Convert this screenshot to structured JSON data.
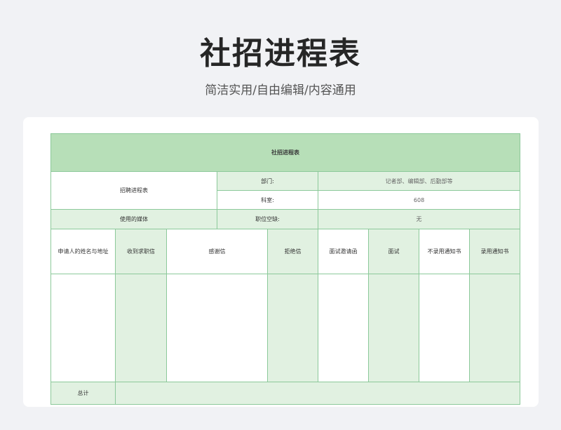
{
  "header": {
    "title": "社招进程表",
    "subtitle": "简洁实用/自由编辑/内容通用"
  },
  "sheet": {
    "title": "社招进程表",
    "recruit_label": "招聘进程表",
    "dept_label": "部门:",
    "dept_value": "记者部、编辑部、后勤部等",
    "room_label": "科室:",
    "room_value": "608",
    "media_label": "使用的媒体",
    "vacancy_label": "职位空缺:",
    "vacancy_value": "无",
    "columns": [
      "申请人的姓名与地址",
      "收到求职信",
      "感谢信",
      "拒绝信",
      "面试邀请函",
      "面试",
      "不录用通知书",
      "录用通知书"
    ],
    "total_label": "总计"
  },
  "colors": {
    "title_band": "#b7dfb8",
    "light_green": "#e1f1e1",
    "border": "#8cc99a",
    "background": "#f1f2f5"
  }
}
